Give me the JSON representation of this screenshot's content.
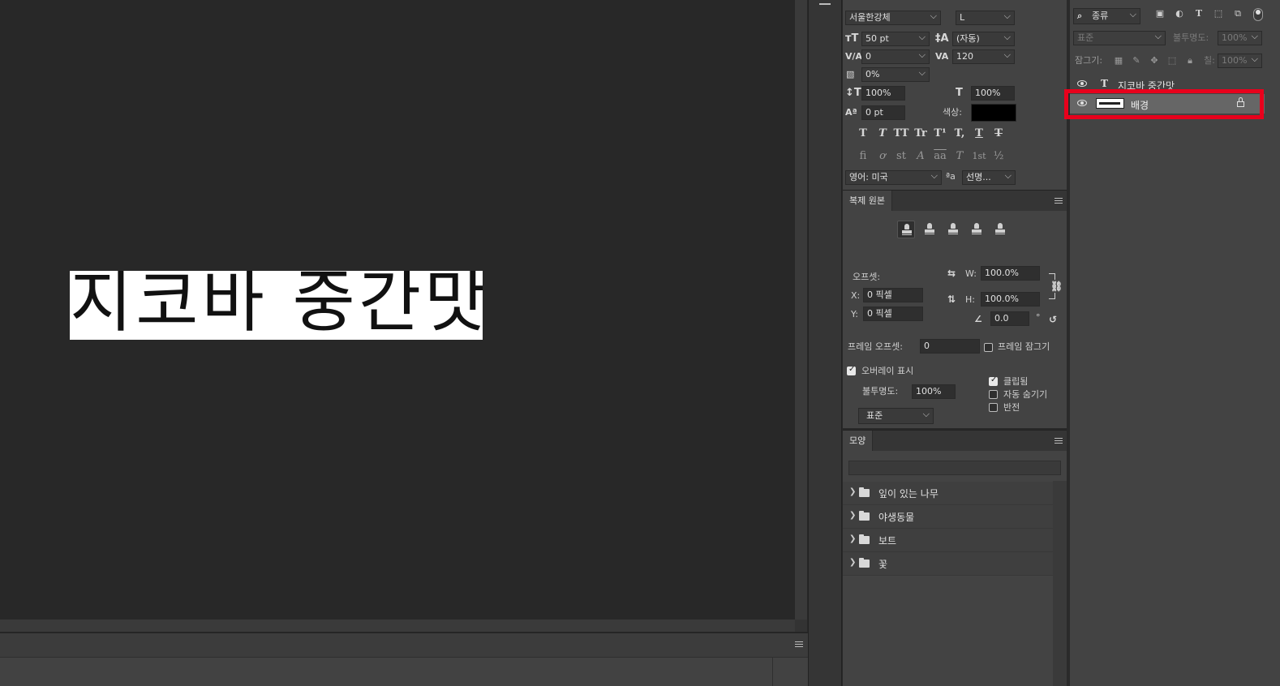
{
  "canvas": {
    "document_text": "지코바 중간맛"
  },
  "character_panel": {
    "font_family": "서울한강체",
    "font_style": "L",
    "font_size": "50 pt",
    "leading": "(자동)",
    "kerning": "0",
    "tracking": "120",
    "tsume": "0%",
    "vertical_scale": "100%",
    "horizontal_scale": "100%",
    "baseline_shift": "0 pt",
    "color_label": "색상:",
    "color": "#000000",
    "language": "영어: 미국",
    "antialias": "선명...",
    "aa_icon": "ªa",
    "style_buttons": [
      "T",
      "T",
      "TT",
      "Tr",
      "T¹",
      "T,",
      "T",
      "T"
    ],
    "opentype_buttons": [
      "fi",
      "ơ",
      "st",
      "A",
      "aa",
      "T",
      "1st",
      "½"
    ]
  },
  "clone_source_panel": {
    "tab": "복제 원본",
    "offset_label": "오프셋:",
    "x_label": "X:",
    "x_value": "0 픽셀",
    "y_label": "Y:",
    "y_value": "0 픽셀",
    "w_label": "W:",
    "w_value": "100.0%",
    "h_label": "H:",
    "h_value": "100.0%",
    "angle_value": "0.0",
    "degree": "°",
    "frame_offset_label": "프레임 오프셋:",
    "frame_offset_value": "0",
    "frame_lock_label": "프레임 잠그기",
    "show_overlay_label": "오버레이 표시",
    "show_overlay_checked": true,
    "opacity_label": "불투명도:",
    "opacity_value": "100%",
    "clipped_label": "클립됨",
    "clipped_checked": true,
    "auto_hide_label": "자동 숨기기",
    "invert_label": "반전",
    "blend_mode": "표준"
  },
  "shapes_panel": {
    "tab": "모양",
    "groups": [
      "잎이 있는 나무",
      "야생동물",
      "보트",
      "꽃"
    ]
  },
  "layers_panel": {
    "filter_kind": "종류",
    "blend_mode": "표준",
    "opacity_label": "불투명도:",
    "opacity_value": "100%",
    "lock_label": "잠그기:",
    "fill_label": "칠:",
    "fill_value": "100%",
    "layers": [
      {
        "name": "지코바 중간맛",
        "type": "text",
        "visible": true,
        "locked": false
      },
      {
        "name": "배경",
        "type": "background",
        "visible": true,
        "locked": true,
        "highlighted": true
      }
    ],
    "highlight_color": "#e8001c"
  }
}
